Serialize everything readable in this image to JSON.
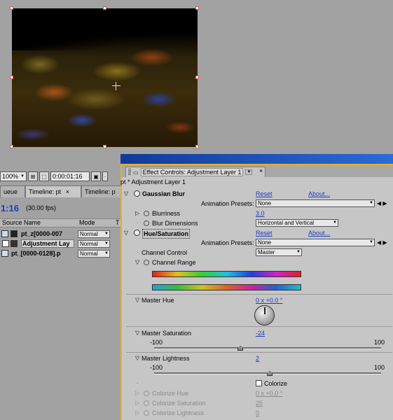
{
  "viewer": {
    "zoom": "100%",
    "timecode": "0:00:01:16"
  },
  "timeline": {
    "tabs": [
      "ueue",
      "Timeline: pt",
      "Timeline: p"
    ],
    "tab_close": "×",
    "current_time": "1:16",
    "fps": "(30.00 fps)",
    "columns": {
      "source": "Source Name",
      "mode": "Mode",
      "t": "T"
    },
    "layers": [
      {
        "name": "pt_z[0000-007",
        "mode": "Normal"
      },
      {
        "name": "Adjustment Lay",
        "mode": "Normal"
      },
      {
        "name": "pt_[0000-0128].p",
        "mode": "Normal"
      }
    ]
  },
  "effect_controls": {
    "tab_title": "Effect Controls: Adjustment Layer 1",
    "tab_close": "×",
    "subtitle": "pt * Adjustment Layer 1",
    "gaussian_blur": {
      "name": "Gaussian Blur",
      "reset": "Reset",
      "about": "About...",
      "presets_label": "Animation Presets:",
      "presets_value": "None",
      "blurriness_label": "Blurriness",
      "blurriness_value": "3.0",
      "dimensions_label": "Blur Dimensions",
      "dimensions_value": "Horizontal and Vertical"
    },
    "hue_saturation": {
      "name": "Hue/Saturation",
      "reset": "Reset",
      "about": "About...",
      "presets_label": "Animation Presets:",
      "presets_value": "None",
      "channel_control_label": "Channel Control",
      "channel_control_value": "Master",
      "channel_range_label": "Channel Range",
      "master_hue_label": "Master Hue",
      "master_hue_value": "0 x +0.0 °",
      "master_saturation_label": "Master Saturation",
      "master_saturation_value": "-24",
      "master_saturation_min": "-100",
      "master_saturation_max": "100",
      "master_saturation_fraction": 0.38,
      "master_lightness_label": "Master Lightness",
      "master_lightness_value": "2",
      "master_lightness_min": "-100",
      "master_lightness_max": "100",
      "master_lightness_fraction": 0.51,
      "colorize_label": "Colorize",
      "colorize_hue_label": "Colorize Hue",
      "colorize_hue_value": "0 x +0.0 °",
      "colorize_saturation_label": "Colorize Saturation",
      "colorize_saturation_value": "25",
      "colorize_lightness_label": "Colorize Lightness",
      "colorize_lightness_value": "0"
    }
  }
}
